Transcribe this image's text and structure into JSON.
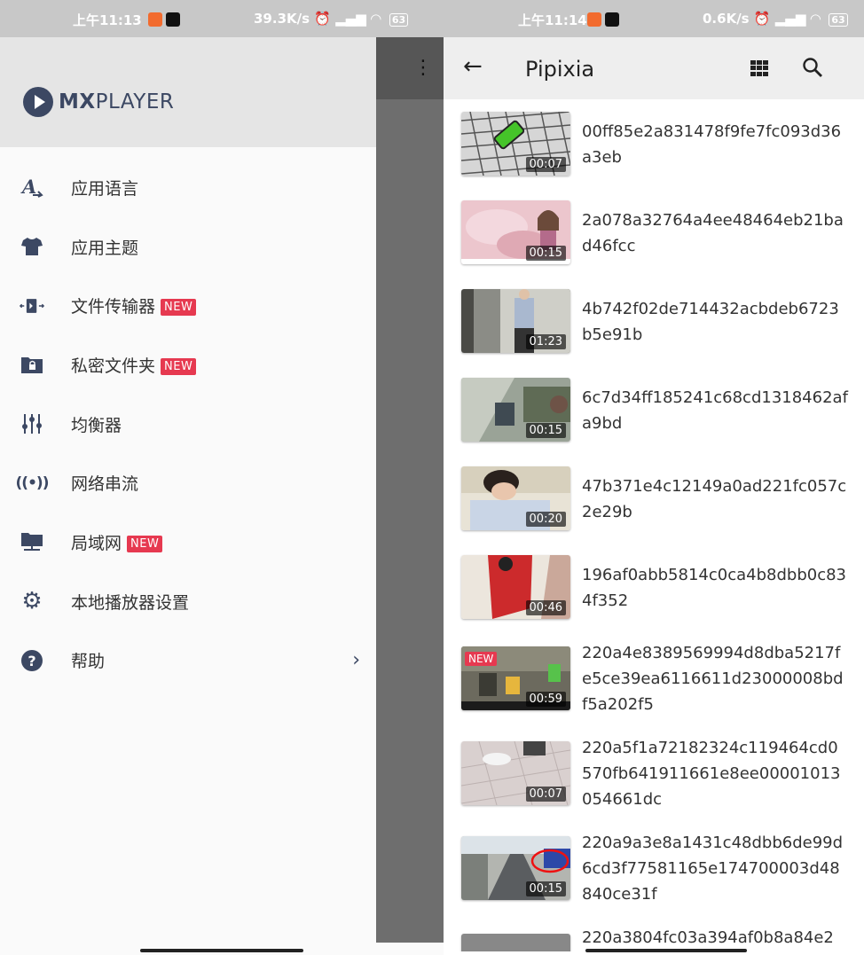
{
  "left_status": {
    "time": "上午11:13",
    "speed": "39.3K/s",
    "battery": "63"
  },
  "right_status": {
    "time": "上午11:14",
    "speed": "0.6K/s",
    "battery": "63"
  },
  "drawer": {
    "brand_bold": "MX",
    "brand_rest": "PLAYER",
    "items": [
      {
        "label": "应用语言",
        "icon": "language-icon",
        "badge": ""
      },
      {
        "label": "应用主题",
        "icon": "tshirt-icon",
        "badge": ""
      },
      {
        "label": "文件传输器",
        "icon": "file-transfer-icon",
        "badge": "NEW"
      },
      {
        "label": "私密文件夹",
        "icon": "private-folder-icon",
        "badge": "NEW"
      },
      {
        "label": "均衡器",
        "icon": "equalizer-icon",
        "badge": ""
      },
      {
        "label": "网络串流",
        "icon": "stream-icon",
        "badge": ""
      },
      {
        "label": "局域网",
        "icon": "lan-icon",
        "badge": "NEW"
      },
      {
        "label": "本地播放器设置",
        "icon": "gear-icon",
        "badge": ""
      },
      {
        "label": "帮助",
        "icon": "help-icon",
        "badge": ""
      }
    ]
  },
  "appbar": {
    "title": "Pipixia"
  },
  "videos": [
    {
      "name": "00ff85e2a831478f9fe7fc093d36a3eb",
      "duration": "00:07",
      "new": ""
    },
    {
      "name": "2a078a32764a4ee48464eb21bad46fcc",
      "duration": "00:15",
      "new": ""
    },
    {
      "name": "4b742f02de714432acbdeb6723b5e91b",
      "duration": "01:23",
      "new": ""
    },
    {
      "name": "6c7d34ff185241c68cd1318462afa9bd",
      "duration": "00:15",
      "new": ""
    },
    {
      "name": "47b371e4c12149a0ad221fc057c2e29b",
      "duration": "00:20",
      "new": ""
    },
    {
      "name": "196af0abb5814c0ca4b8dbb0c834f352",
      "duration": "00:46",
      "new": ""
    },
    {
      "name": "220a4e8389569994d8dba5217fe5ce39ea6116611d23000008bdf5a202f5",
      "duration": "00:59",
      "new": "NEW"
    },
    {
      "name": "220a5f1a72182324c119464cd0570fb641911661e8ee00001013054661dc",
      "duration": "00:07",
      "new": ""
    },
    {
      "name": "220a9a3e8a1431c48dbb6de99d6cd3f77581165e174700003d48840ce31f",
      "duration": "00:15",
      "new": ""
    },
    {
      "name": "220a3804fc03a394af0b8a84e2",
      "duration": "",
      "new": ""
    }
  ],
  "colors": {
    "accent": "#3c4863",
    "badge": "#e63950"
  }
}
